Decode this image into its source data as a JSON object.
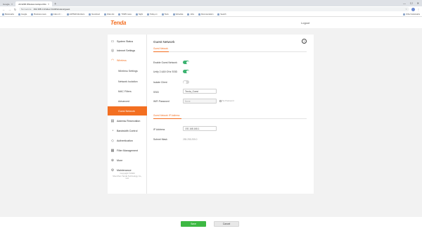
{
  "browser": {
    "tabs": [
      {
        "label": "Google",
        "active": false
      },
      {
        "label": "AC1200 Wireless Hotspot Router",
        "active": true
      }
    ],
    "new_tab": "+",
    "window_controls": [
      "—",
      "☐",
      "✕"
    ],
    "address": {
      "security": "Not secure",
      "url": "192.168.1.1/index.html#/wireless/guest"
    },
    "bookmarks": [
      "Bookmarks",
      "Google",
      "Business news",
      "Index of /...",
      "LIMITED Members",
      "Nextcloud",
      "Video list",
      "TOWN news",
      "Night",
      "Today on",
      "Tools",
      "Schedule",
      "Jobs",
      "Documentation",
      "Search",
      "Other"
    ],
    "bookmarks_right": "Other bookmarks"
  },
  "header": {
    "logo": "Tenda",
    "logout": "Logout"
  },
  "sidebar": {
    "items": [
      {
        "label": "System Status",
        "icon": "monitor-icon",
        "glyph": "▭"
      },
      {
        "label": "Internet Settings",
        "icon": "globe-icon",
        "glyph": "◎"
      },
      {
        "label": "Wireless",
        "icon": "wifi-icon",
        "glyph": "◠",
        "state": "expanded"
      },
      {
        "label": "Wireless Settings",
        "sub": true
      },
      {
        "label": "Network Isolation",
        "sub": true
      },
      {
        "label": "MAC Filters",
        "sub": true
      },
      {
        "label": "Advanced",
        "sub": true
      },
      {
        "label": "Guest Network",
        "sub": true,
        "state": "active"
      },
      {
        "label": "Address Reservation",
        "icon": "address-icon",
        "glyph": "▤"
      },
      {
        "label": "Bandwidth Control",
        "icon": "bandwidth-icon",
        "glyph": "◔"
      },
      {
        "label": "Authentication",
        "icon": "shield-icon",
        "glyph": "◇"
      },
      {
        "label": "Filter Management",
        "icon": "filter-icon",
        "glyph": "▦"
      },
      {
        "label": "More",
        "icon": "more-icon",
        "glyph": "⊕"
      },
      {
        "label": "Maintenance",
        "icon": "gear-icon",
        "glyph": "⚙"
      }
    ],
    "copyright": [
      "Copyright ©2020",
      "Shenzhen Tenda Technology Co.,",
      "Ltd."
    ]
  },
  "content": {
    "title": "Guest Network",
    "help_icon": "?",
    "section1": "Guest Network",
    "enable_guest_label": "Enable Guest Network",
    "enable_guest_on": true,
    "unify_label": "Unify 2.4&5 GHz SSID",
    "unify_on": true,
    "isolate_label": "Isolate Client",
    "isolate_on": false,
    "ssid_label": "SSID",
    "ssid_value": "Tenda_Guest",
    "wifi_password_label": "WiFi Password",
    "wifi_password_value": "None",
    "no_password_label": "No Password",
    "section2": "Guest Network IP Address",
    "ip_label": "IP Address",
    "ip_value": "192.168.168.1",
    "mask_label": "Subnet Mask",
    "mask_value": "255.255.255.0"
  },
  "footer": {
    "save": "Save",
    "cancel": "Cancel"
  },
  "colors": {
    "accent": "#f36f21",
    "toggle_on": "#3cb371",
    "save": "#3db843"
  }
}
